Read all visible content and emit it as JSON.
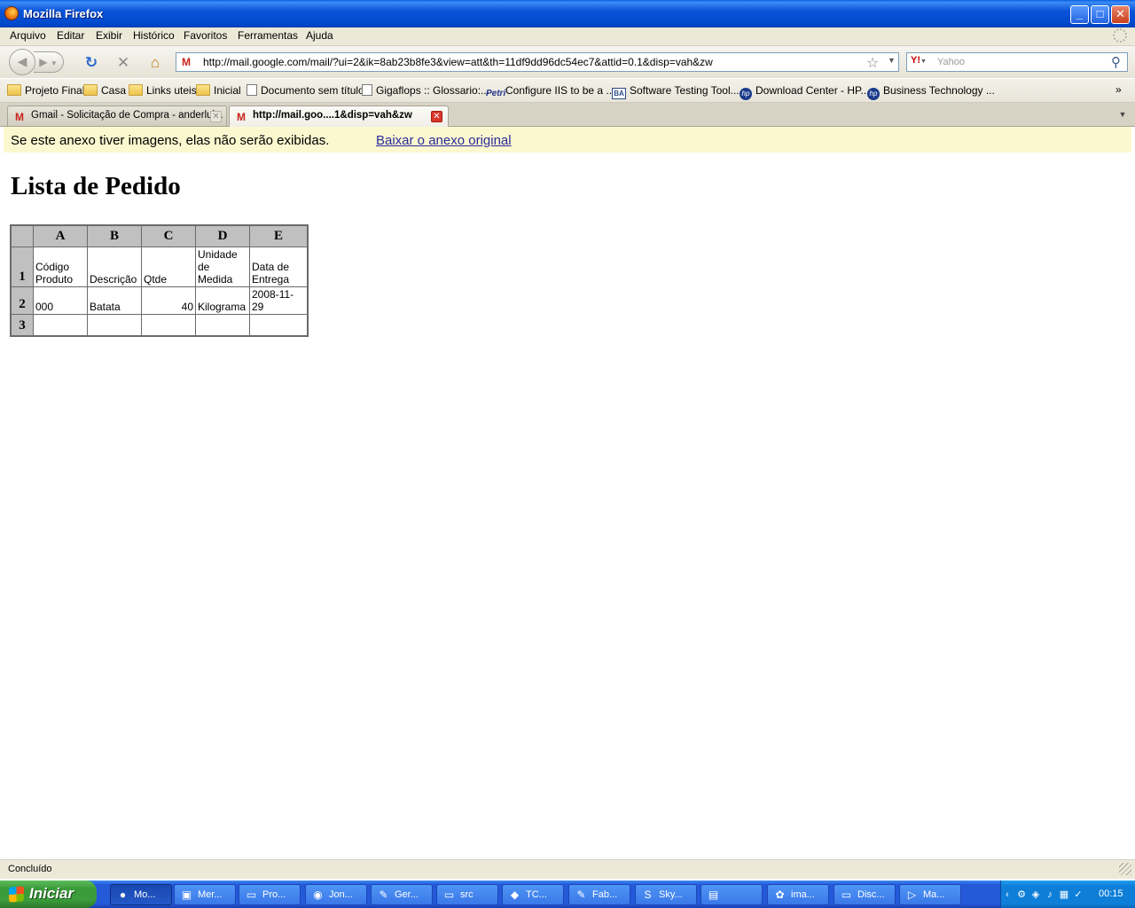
{
  "window": {
    "title": "Mozilla Firefox",
    "buttons": [
      "_",
      "□",
      "✕"
    ]
  },
  "menu": [
    "Arquivo",
    "Editar",
    "Exibir",
    "Histórico",
    "Favoritos",
    "Ferramentas",
    "Ajuda"
  ],
  "nav": {
    "url": "http://mail.google.com/mail/?ui=2&ik=8ab23b8fe3&view=att&th=11df9dd96dc54ec7&attid=0.1&disp=vah&zw",
    "search_placeholder": "Yahoo",
    "search_engine_label": "Y!"
  },
  "bookmarks": [
    {
      "label": "Projeto Final",
      "icon": "folder-icon"
    },
    {
      "label": "Casa",
      "icon": "folder-icon"
    },
    {
      "label": "Links uteis",
      "icon": "folder-icon"
    },
    {
      "label": "Inicial",
      "icon": "folder-icon"
    },
    {
      "label": "Documento sem título",
      "icon": "page-icon"
    },
    {
      "label": "Gigaflops :: Glossario:...",
      "icon": "page-icon"
    },
    {
      "label": "Configure IIS to be a ...",
      "icon": "petri-icon"
    },
    {
      "label": "Software Testing Tool...",
      "icon": "ba-icon"
    },
    {
      "label": "Download Center - HP...",
      "icon": "hp-icon"
    },
    {
      "label": "Business Technology ...",
      "icon": "hp-icon"
    }
  ],
  "tabs": [
    {
      "label": "Gmail - Solicitação de Compra - anderlui...",
      "active": false
    },
    {
      "label": "http://mail.goo....1&disp=vah&zw",
      "active": true
    }
  ],
  "page": {
    "notice": "Se este anexo tiver imagens, elas não serão exibidas.",
    "notice_link": "Baixar o anexo original",
    "heading": "Lista de Pedido",
    "sheet": {
      "columns": [
        "A",
        "B",
        "C",
        "D",
        "E"
      ],
      "rows": [
        {
          "num": "1",
          "cells": [
            "Código\nProduto",
            "Descrição",
            "Qtde",
            "Unidade\nde Medida",
            "Data de\nEntrega"
          ]
        },
        {
          "num": "2",
          "cells": [
            "000",
            "Batata",
            "40",
            "Kilograma",
            "2008-11-29"
          ]
        },
        {
          "num": "3",
          "cells": [
            "",
            "",
            "",
            "",
            ""
          ]
        }
      ]
    }
  },
  "status": "Concluído",
  "taskbar": {
    "start": "Iniciar",
    "tasks": [
      "Mo...",
      "Mer...",
      "Pro...",
      "Jon...",
      "Ger...",
      "src",
      "TC...",
      "Fab...",
      "Sky...",
      "",
      "ima...",
      "Disc...",
      "Ma..."
    ],
    "clock": "00:15"
  }
}
